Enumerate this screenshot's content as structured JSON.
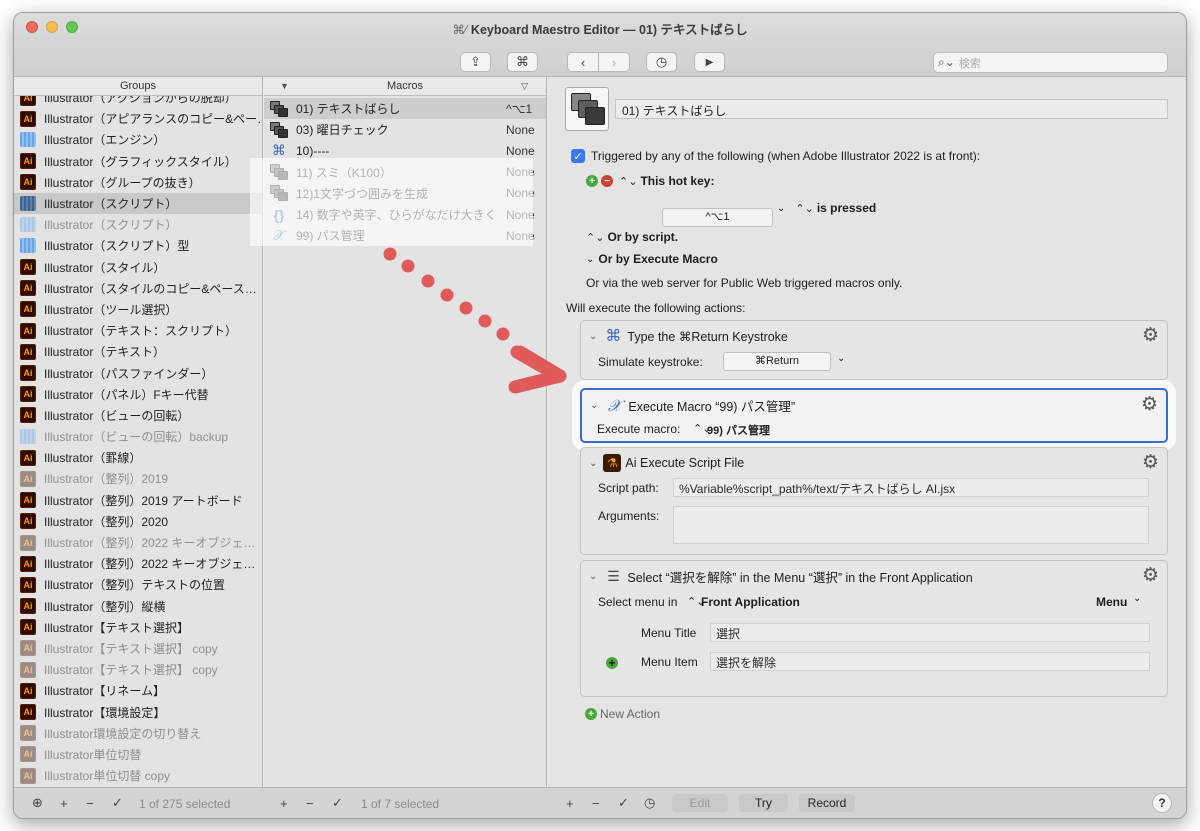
{
  "window": {
    "title": "Keyboard Maestro Editor — 01) テキストばらし",
    "title_icon": "⌘⁄"
  },
  "toolbar": {
    "share_icon": "⇪",
    "cmd_icon": "⌘",
    "back_icon": "‹",
    "forward_icon": "›",
    "clock_icon": "◷",
    "run_icon": "▶",
    "search_placeholder": "検索"
  },
  "groups": {
    "header": "Groups",
    "items": [
      {
        "label": "Illustrator（アクションからの脱却）",
        "icon": "ai",
        "dim": false
      },
      {
        "label": "Illustrator（アピアランスのコピー&ペー…",
        "icon": "ai",
        "dim": false
      },
      {
        "label": "Illustrator（エンジン）",
        "icon": "folder",
        "dim": false
      },
      {
        "label": "Illustrator（グラフィックスタイル）",
        "icon": "ai",
        "dim": false
      },
      {
        "label": "Illustrator（グループの抜き）",
        "icon": "ai",
        "dim": false
      },
      {
        "label": "Illustrator（スクリプト）",
        "icon": "folder-dark",
        "dim": false,
        "selected": true
      },
      {
        "label": "Illustrator（スクリプト）",
        "icon": "folder",
        "dim": true
      },
      {
        "label": "Illustrator（スクリプト）型",
        "icon": "folder",
        "dim": false
      },
      {
        "label": "Illustrator（スタイル）",
        "icon": "ai",
        "dim": false
      },
      {
        "label": "Illustrator（スタイルのコピー&ペース…",
        "icon": "ai",
        "dim": false
      },
      {
        "label": "Illustrator（ツール選択）",
        "icon": "ai",
        "dim": false
      },
      {
        "label": "Illustrator（テキスト：スクリプト）",
        "icon": "ai",
        "dim": false
      },
      {
        "label": "Illustrator（テキスト）",
        "icon": "ai",
        "dim": false
      },
      {
        "label": "Illustrator（パスファインダー）",
        "icon": "ai",
        "dim": false
      },
      {
        "label": "Illustrator（パネル）Fキー代替",
        "icon": "ai",
        "dim": false
      },
      {
        "label": "Illustrator（ビューの回転）",
        "icon": "ai",
        "dim": false
      },
      {
        "label": "Illustrator（ビューの回転）backup",
        "icon": "folder",
        "dim": true
      },
      {
        "label": "Illustrator（罫線）",
        "icon": "ai",
        "dim": false
      },
      {
        "label": "Illustrator（整列）2019",
        "icon": "ai",
        "dim": true
      },
      {
        "label": "Illustrator（整列）2019 アートボード",
        "icon": "ai",
        "dim": false
      },
      {
        "label": "Illustrator（整列）2020",
        "icon": "ai",
        "dim": false
      },
      {
        "label": "Illustrator（整列）2022 キーオブジェ…",
        "icon": "ai",
        "dim": true
      },
      {
        "label": "Illustrator（整列）2022 キーオブジェ…",
        "icon": "ai",
        "dim": false
      },
      {
        "label": "Illustrator（整列）テキストの位置",
        "icon": "ai",
        "dim": false
      },
      {
        "label": "Illustrator（整列）縦横",
        "icon": "ai",
        "dim": false
      },
      {
        "label": "Illustrator【テキスト選択】",
        "icon": "ai",
        "dim": false
      },
      {
        "label": "Illustrator【テキスト選択】 copy",
        "icon": "ai",
        "dim": true
      },
      {
        "label": "Illustrator【テキスト選択】 copy",
        "icon": "ai",
        "dim": true
      },
      {
        "label": "Illustrator【リネーム】",
        "icon": "ai",
        "dim": false
      },
      {
        "label": "Illustrator【環境設定】",
        "icon": "ai",
        "dim": false
      },
      {
        "label": "Illustrator環境設定の切り替え",
        "icon": "ai",
        "dim": true
      },
      {
        "label": "Illustrator単位切替",
        "icon": "ai",
        "dim": true
      },
      {
        "label": "Illustrator単位切替 copy",
        "icon": "ai",
        "dim": true
      }
    ],
    "status": "1 of 275 selected"
  },
  "macros": {
    "header": "Macros",
    "items": [
      {
        "label": "01) テキストばらし",
        "key": "^⌥1",
        "icon": "stack",
        "selected": true
      },
      {
        "label": "03) 曜日チェック",
        "key": "None",
        "icon": "stack"
      },
      {
        "label": "10)----",
        "key": "None",
        "icon": "cmd"
      },
      {
        "label": "11) スミ（K100）",
        "key": "None",
        "icon": "stack"
      },
      {
        "label": "12)1文字づつ囲みを生成",
        "key": "None",
        "icon": "stack"
      },
      {
        "label": "14) 数字や英字、ひらがなだけ大きく",
        "key": "None",
        "icon": "braces"
      },
      {
        "label": "99) パス管理",
        "key": "None",
        "icon": "script"
      }
    ],
    "status": "1 of 7 selected"
  },
  "editor": {
    "macro_name": "01) テキストばらし",
    "trigger_text": "Triggered by any of the following (when Adobe Illustrator 2022 is at front):",
    "hotkey_label": "This hot key:",
    "hotkey_value": "^⌥1",
    "is_pressed": "is pressed",
    "or_script": "Or by script.",
    "or_execute": "Or by Execute Macro",
    "web_server": "Or via the web server for Public Web triggered macros only.",
    "will_execute": "Will execute the following actions:",
    "actions": [
      {
        "title": "Type the ⌘Return Keystroke",
        "label": "Simulate keystroke:",
        "value": "⌘Return"
      },
      {
        "title": "Execute Macro “99) パス管理”",
        "label": "Execute macro:",
        "value": "99) パス管理"
      },
      {
        "title": "Ai Execute Script File",
        "path_label": "Script path:",
        "path_value": "%Variable%script_path%/text/テキストばらし AI.jsx",
        "args_label": "Arguments:"
      },
      {
        "title": "Select “選択を解除” in the Menu “選択” in the Front Application",
        "select_label": "Select menu in",
        "select_value": "Front Application",
        "menu_dropdown": "Menu",
        "menu_title_label": "Menu Title",
        "menu_title_value": "選択",
        "menu_item_label": "Menu Item",
        "menu_item_value": "選択を解除"
      }
    ],
    "new_action": "New Action"
  },
  "bottom": {
    "edit": "Edit",
    "try": "Try",
    "record": "Record",
    "help": "?"
  },
  "colors": {
    "accent": "#3a6ad4",
    "arrow": "#e05a5a"
  }
}
